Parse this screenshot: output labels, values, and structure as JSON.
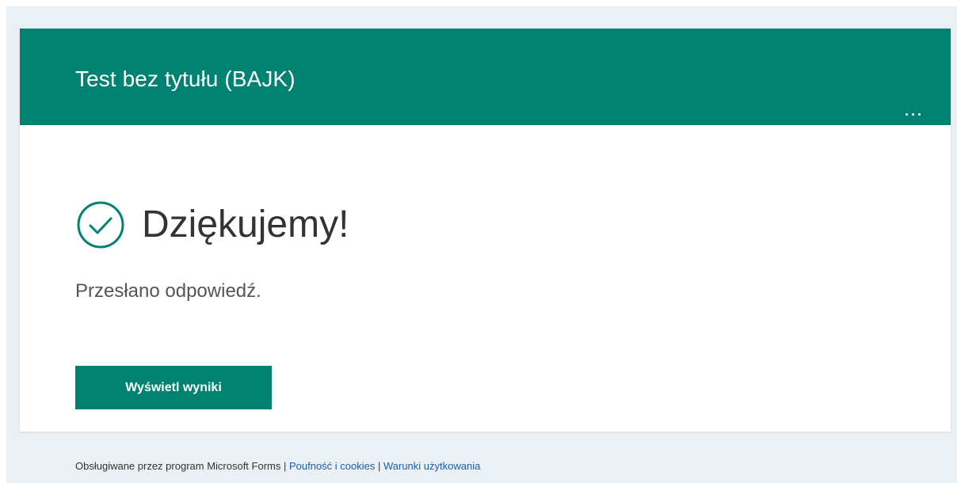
{
  "form": {
    "title": "Test bez tytułu (BAJK)",
    "more_options_icon": "ellipsis-icon"
  },
  "confirmation": {
    "heading": "Dziękujemy!",
    "message": "Przesłano odpowiedź.",
    "icon": "check-circle-icon",
    "view_results_label": "Wyświetl wyniki"
  },
  "footer": {
    "powered_by": "Obsługiwane przez program Microsoft Forms",
    "separator_1": " | ",
    "privacy_link": "Poufność i cookies",
    "separator_2": " | ",
    "terms_link": "Warunki użytkowania"
  },
  "colors": {
    "accent": "#008272",
    "page_background": "#eaf0f4",
    "link": "#1a5fb4"
  }
}
